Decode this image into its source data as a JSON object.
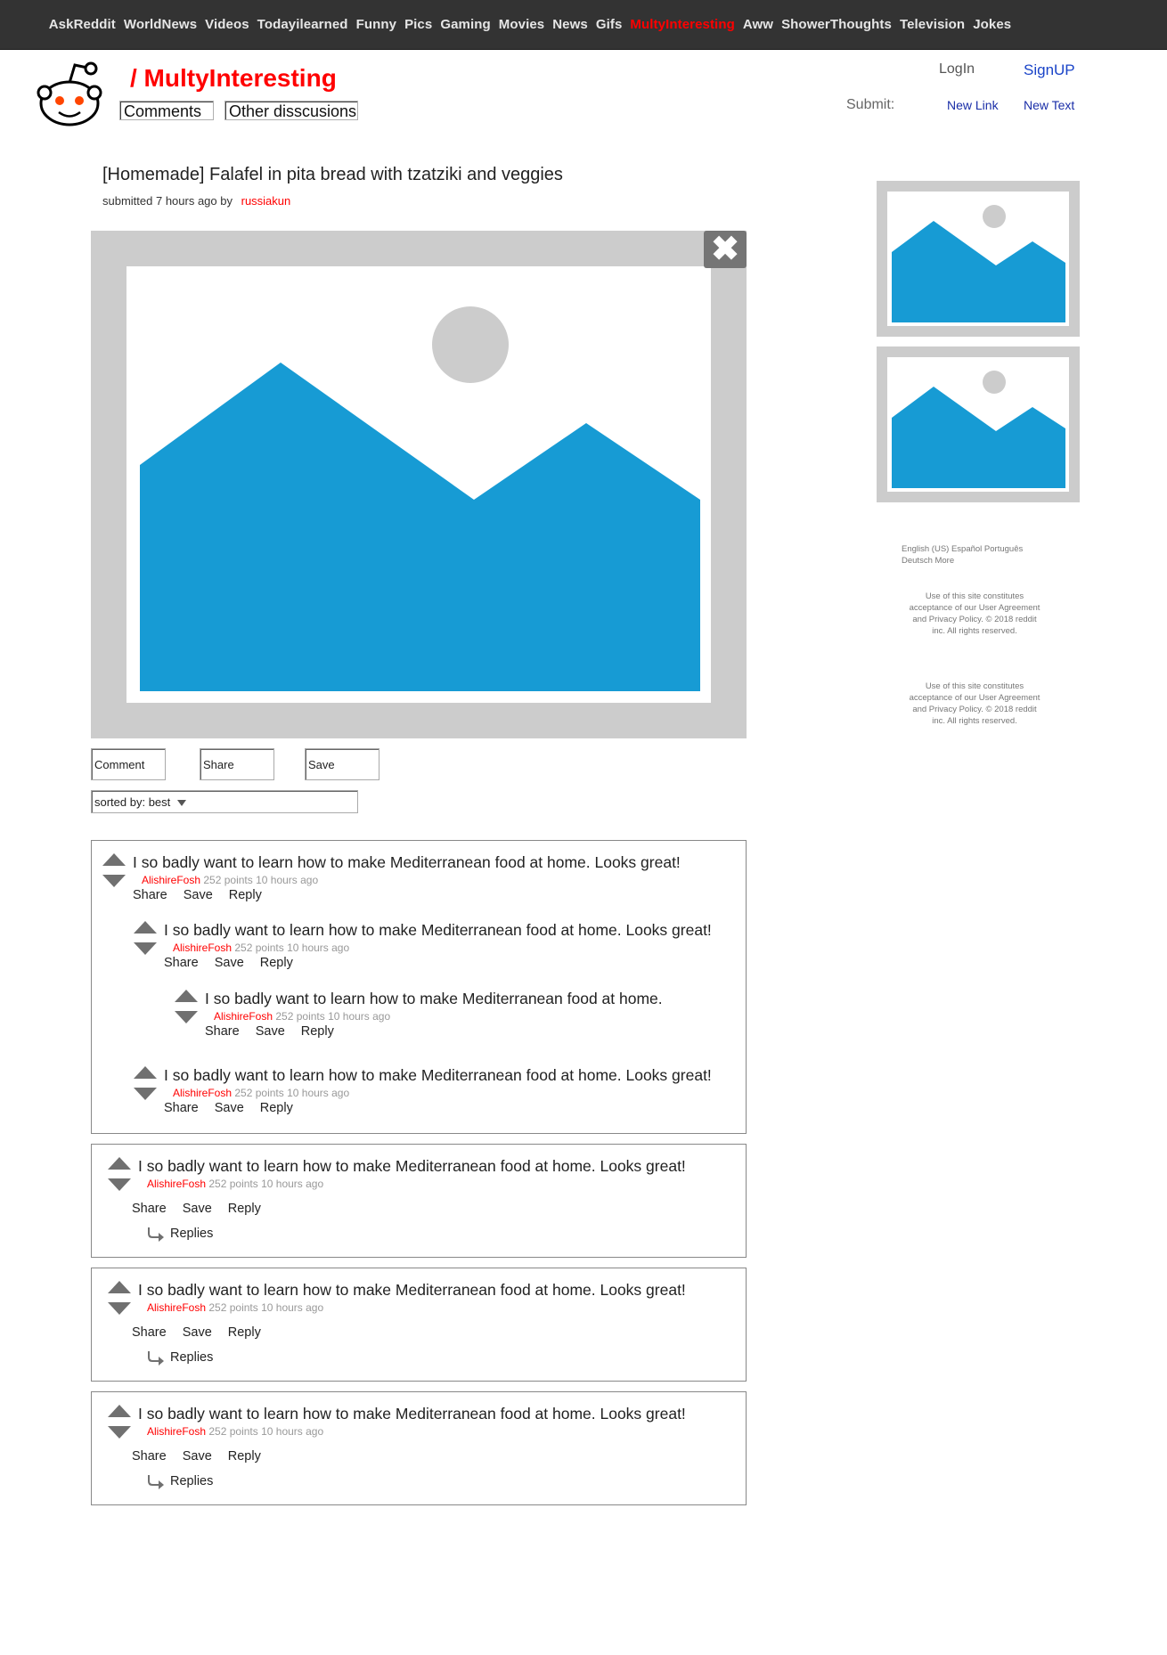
{
  "nav": {
    "items": [
      "AskReddit",
      "WorldNews",
      "Videos",
      "Todayilearned",
      "Funny",
      "Pics",
      "Gaming",
      "Movies",
      "News",
      "Gifs",
      "MultyInteresting",
      "Aww",
      "ShowerThoughts",
      "Television",
      "Jokes"
    ],
    "active": "MultyInteresting"
  },
  "header": {
    "subreddit": "/ MultyInteresting",
    "tab_comments": "Comments",
    "tab_other": "Other disscusions",
    "login": "LogIn",
    "signup": "SignUP",
    "submit_label": "Submit:",
    "new_link": "New Link",
    "new_text": "New Text"
  },
  "post": {
    "title": "[Homemade] Falafel in pita bread with tzatziki and veggies",
    "submitted_prefix": "submitted 7 hours ago by",
    "author": "russiakun"
  },
  "actions": {
    "comment": "Comment",
    "share": "Share",
    "save": "Save"
  },
  "sort": {
    "label": "sorted by: best"
  },
  "comment_actions": {
    "share": "Share",
    "save": "Save",
    "reply": "Reply",
    "replies": "Replies"
  },
  "comments": [
    {
      "text": "I so badly want to learn how to make Mediterranean food at home. Looks great!",
      "author": "AlishireFosh",
      "meta": "252 points 10 hours ago"
    },
    {
      "text": "I so badly want to learn how to make Mediterranean food at home. Looks great!",
      "author": "AlishireFosh",
      "meta": "252 points 10 hours ago"
    },
    {
      "text": "I so badly want to learn how to make Mediterranean food at home.",
      "author": "AlishireFosh",
      "meta": "252 points 10 hours ago"
    },
    {
      "text": "I so badly want to learn how to make Mediterranean food at home. Looks great!",
      "author": "AlishireFosh",
      "meta": "252 points 10 hours ago"
    },
    {
      "text": "I so badly want to learn how to make Mediterranean food at home. Looks great!",
      "author": "AlishireFosh",
      "meta": "252 points 10 hours ago"
    },
    {
      "text": "I so badly want to learn how to make Mediterranean food at home. Looks great!",
      "author": "AlishireFosh",
      "meta": "252 points 10 hours ago"
    },
    {
      "text": "I so badly want to learn how to make Mediterranean food at home. Looks great!",
      "author": "AlishireFosh",
      "meta": "252 points 10 hours ago"
    }
  ],
  "footer": {
    "languages_line1": "English (US)  Español  Português",
    "languages_line2": "Deutsch  More",
    "legal_1": [
      "Use of this site constitutes",
      "acceptance of our User Agreement",
      "and Privacy Policy. © 2018 reddit",
      "inc. All rights reserved."
    ],
    "legal_2": [
      "Use of this site constitutes",
      "acceptance of our User Agreement",
      "and Privacy Policy. © 2018 reddit",
      "inc. All rights reserved."
    ]
  },
  "colors": {
    "accent": "#ff0000",
    "nav_bg": "#333333",
    "image_blue": "#179bd4",
    "frame_gray": "#cccccc",
    "link_blue": "#1a44c8"
  },
  "icons": {
    "logo": "reddit-alien-icon",
    "close": "close-icon",
    "upvote": "upvote-arrow-icon",
    "downvote": "downvote-arrow-icon",
    "reply": "reply-arrow-icon",
    "sort": "chevron-down-icon",
    "image": "image-placeholder-icon"
  }
}
